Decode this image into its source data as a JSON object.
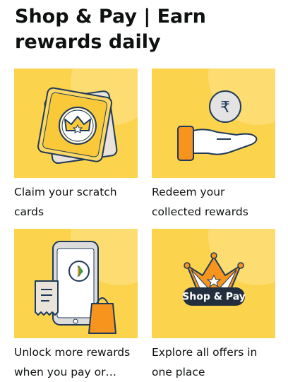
{
  "widget": {
    "title": "Shop & Pay | Earn rewards daily"
  },
  "tiles": [
    {
      "label": "Claim your scratch cards",
      "icon": "scratch-card-crown-icon"
    },
    {
      "label": "Redeem your collected rewards",
      "icon": "rupee-coin-hand-icon"
    },
    {
      "label": "Unlock more rewards when you pay or…",
      "icon": "phone-upi-bills-bag-icon"
    },
    {
      "label": "Explore all offers in one place",
      "icon": "crown-shop-and-pay-icon",
      "badge": "Shop & Pay"
    }
  ],
  "colors": {
    "tile_bg": "#fcd34d",
    "tile_bg_light": "#fde58a",
    "accent_orange": "#f7941d",
    "navy": "#232f3e",
    "outline": "#1f3a5a"
  }
}
